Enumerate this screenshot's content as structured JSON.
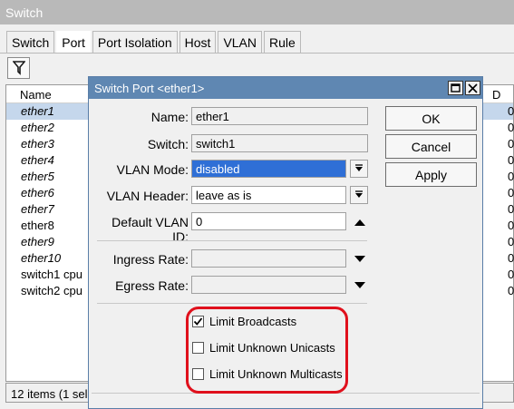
{
  "main": {
    "title": "Switch",
    "tabs": [
      "Switch",
      "Port",
      "Port Isolation",
      "Host",
      "VLAN",
      "Rule"
    ],
    "list_header_name": "Name",
    "list_header_right": "D",
    "rows": [
      {
        "name": "ether1",
        "val": "0",
        "italic": true,
        "selected": true
      },
      {
        "name": "ether2",
        "val": "0",
        "italic": true
      },
      {
        "name": "ether3",
        "val": "0",
        "italic": true
      },
      {
        "name": "ether4",
        "val": "0",
        "italic": true
      },
      {
        "name": "ether5",
        "val": "0",
        "italic": true
      },
      {
        "name": "ether6",
        "val": "0",
        "italic": true
      },
      {
        "name": "ether7",
        "val": "0",
        "italic": true
      },
      {
        "name": "ether8",
        "val": "0",
        "italic": false
      },
      {
        "name": "ether9",
        "val": "0",
        "italic": true
      },
      {
        "name": "ether10",
        "val": "0",
        "italic": true
      },
      {
        "name": "switch1 cpu",
        "val": "0",
        "italic": false
      },
      {
        "name": "switch2 cpu",
        "val": "0",
        "italic": false
      }
    ],
    "status": "12 items (1 sel"
  },
  "dialog": {
    "title": "Switch Port <ether1>",
    "fields": {
      "name_label": "Name:",
      "name_value": "ether1",
      "switch_label": "Switch:",
      "switch_value": "switch1",
      "vlan_mode_label": "VLAN Mode:",
      "vlan_mode_value": "disabled",
      "vlan_header_label": "VLAN Header:",
      "vlan_header_value": "leave as is",
      "default_vlan_label": "Default VLAN ID:",
      "default_vlan_value": "0",
      "ingress_label": "Ingress Rate:",
      "ingress_value": "",
      "egress_label": "Egress Rate:",
      "egress_value": ""
    },
    "buttons": {
      "ok": "OK",
      "cancel": "Cancel",
      "apply": "Apply"
    },
    "checkboxes": [
      {
        "label": "Limit Broadcasts",
        "checked": true
      },
      {
        "label": "Limit Unknown Unicasts",
        "checked": false
      },
      {
        "label": "Limit Unknown Multicasts",
        "checked": false
      }
    ]
  },
  "colors": {
    "dialog_title": "#5f87b2",
    "selection": "#2f6fd6",
    "annotation": "#e0101c"
  }
}
